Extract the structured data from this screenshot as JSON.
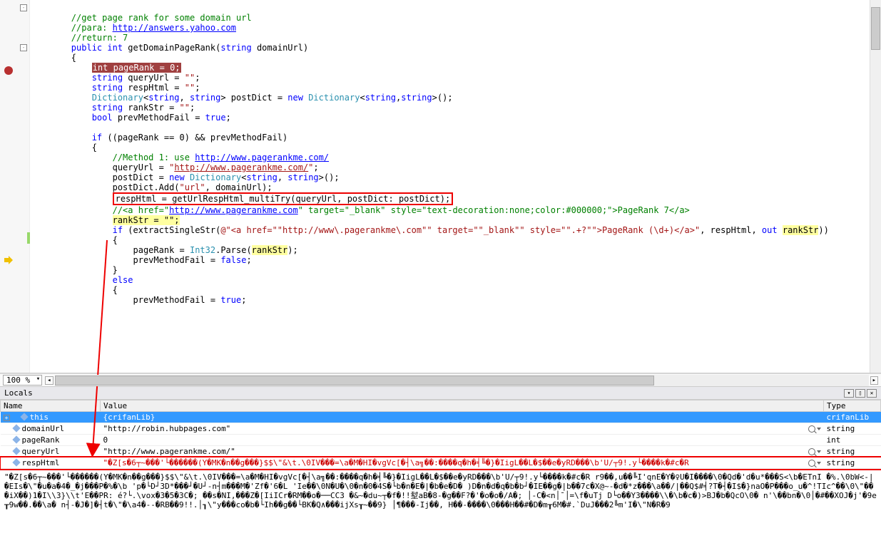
{
  "zoom": "100 %",
  "code": {
    "l1_comment": "//get page rank for some domain url",
    "l2_pre": "//para: ",
    "l2_link": "http://answers.yahoo.com",
    "l3_comment": "//return: 7",
    "l4_public": "public",
    "l4_int": "int",
    "l4_name": " getDomainPageRank(",
    "l4_string": "string",
    "l4_param": " domainUrl)",
    "l5": "{",
    "l6_hl": "int pageRank = 0;",
    "l7_p1": "    ",
    "l7_string": "string",
    "l7_p2": " queryUrl = ",
    "l7_q": "\"\"",
    "l7_p3": ";",
    "l8_p1": "    ",
    "l8_string": "string",
    "l8_p2": " respHtml = ",
    "l8_q": "\"\"",
    "l8_p3": ";",
    "l9_p1": "    ",
    "l9_dict": "Dictionary",
    "l9_p2": "<",
    "l9_str1": "string",
    "l9_p3": ", ",
    "l9_str2": "string",
    "l9_p4": "> postDict = ",
    "l9_new": "new",
    "l9_p5": " ",
    "l9_dict2": "Dictionary",
    "l9_p6": "<",
    "l9_str3": "string",
    "l9_p7": ",",
    "l9_str4": "string",
    "l9_p8": ">();",
    "l10_p1": "    ",
    "l10_string": "string",
    "l10_p2": " rankStr = ",
    "l10_q": "\"\"",
    "l10_p3": ";",
    "l11_p1": "    ",
    "l11_bool": "bool",
    "l11_p2": " prevMethodFail = ",
    "l11_true": "true",
    "l11_p3": ";",
    "l13_p1": "    ",
    "l13_if": "if",
    "l13_p2": " ((pageRank == 0) && prevMethodFail)",
    "l14": "    {",
    "l15_pre": "        ",
    "l15_c1": "//Method 1: use ",
    "l15_link": "http://www.pagerankme.com/",
    "l16_p1": "        queryUrl = ",
    "l16_q": "\"",
    "l16_link": "http://www.pagerankme.com/",
    "l16_q2": "\"",
    "l16_p2": ";",
    "l17_p1": "        postDict = ",
    "l17_new": "new",
    "l17_p2": " ",
    "l17_dict": "Dictionary",
    "l17_p3": "<",
    "l17_s1": "string",
    "l17_p4": ", ",
    "l17_s2": "string",
    "l17_p5": ">();",
    "l18_p1": "        postDict.Add(",
    "l18_q1": "\"url\"",
    "l18_p2": ", domainUrl);",
    "l19_box": "respHtml = getUrlRespHtml_multiTry(queryUrl, postDict: postDict);",
    "l20_pre": "        ",
    "l20_c1": "//<a href=\"",
    "l20_link": "http://www.pagerankme.com",
    "l20_c2": "\" target=\"_blank\" style=\"text-decoration:none;color:#000000;\">PageRank 7</a>",
    "l21_p1": "        ",
    "l21_hl": "rankStr = \"\";",
    "l22_p1": "        ",
    "l22_if": "if",
    "l22_p2": " (extractSingleStr(",
    "l22_at": "@\"<a href=\"\"http://www\\.pagerankme\\.com\"\" target=\"\"_blank\"\" style=\"\".+?\"\">PageRank (\\d+)</a>\"",
    "l22_p3": ", respHtml, ",
    "l22_out": "out",
    "l22_p4": " ",
    "l22_hl": "rankStr",
    "l22_p5": "))",
    "l23": "        {",
    "l24_p1": "            pageRank = ",
    "l24_int32": "Int32",
    "l24_p2": ".Parse(",
    "l24_hl": "rankStr",
    "l24_p3": ");",
    "l25_p1": "            prevMethodFail = ",
    "l25_false": "false",
    "l25_p2": ";",
    "l26": "        }",
    "l27_p1": "        ",
    "l27_else": "else",
    "l28": "        {",
    "l29_p1": "            prevMethodFail = ",
    "l29_true": "true",
    "l29_p2": ";"
  },
  "locals": {
    "title": "Locals",
    "headers": {
      "name": "Name",
      "value": "Value",
      "type": "Type"
    },
    "rows": [
      {
        "name": "this",
        "value": "{crifanLib}",
        "type": "crifanLib",
        "sel": true,
        "expand": true,
        "mag": false
      },
      {
        "name": "domainUrl",
        "value": "\"http://robin.hubpages.com\"",
        "type": "string",
        "mag": true
      },
      {
        "name": "pageRank",
        "value": "0",
        "type": "int",
        "mag": false
      },
      {
        "name": "queryUrl",
        "value": "\"http://www.pagerankme.com/\"",
        "type": "string",
        "mag": true
      },
      {
        "name": "respHtml",
        "value": "\"�Z[s�6┬~���'└������(Y�MK�n��g���}$$\\\"&\\t.\\0IV���=\\a�M�HI�vgVc[�┤\\a╗��:����q�h�╡╚�}�IigL��L�$��e�yRD���\\b'U/┬9!.y└����k�#c�R",
        "type": "string",
        "changed": true,
        "box": true,
        "mag": true
      }
    ]
  },
  "dump": "\"�Z[s�6┬~���'└������(Y�MK�n��g���}$$\\\"&\\t.\\0IV���=\\a�M�HI�vgVc[�┤\\a╗��:����q�h�╡╚�}�IigL��L�$��e�yRD���\\b'U/┬9!.y└����k�#c�R   r9��,u��╚I'qnE�Y�♀U�I����\\0�Qd�'d�u*���S<\\b�ETnI �%.\\0bW<-|�EIs�\\\"�u�a�4�_�j���P�%�\\b 'p�└D┘3D*���┘�U┘-n┤m���M�'Zf�'6�L 'Ie��\\0N�U�\\0�n�0�4S�└b�n�E�|�b�e�D�  )D�n�d�q�b�b┘�IE��g�|b��7c�X@~-�d�*z���\\a��/|��Q$#╡?T�┤�I$�}naO�P���o_u�^!TIc^��\\0\\\"���iX��)1�I\\\\3}\\\\t'E��PR: é?└.\\vox�3�5�3C�; ��s�NI,���Z�[IiICr�RM��o�──CC3 �&~�du~┬�f�!!堼aB�8-�g��F?�'�o�o�/A�; │-C�<n│¯│=\\f�uTj D└o��Y3����\\\\�\\b�c�)>BJ�b�QcO\\0� n'\\��bn�\\0│�#��XOJ�j'�9e┰9w��.��\\a� n┤-�J�]�┤t�\\\"�\\a4�--�RB��9!!.│┒\\\"y���co�b�└Ih��g��└BK�Q∧���ijXs┰~��9}  │¶���-Ij��, H��-����\\0���H��#�D�m┰6M�#.`DuJ���2╚m'I�\\\"N�R�9"
}
